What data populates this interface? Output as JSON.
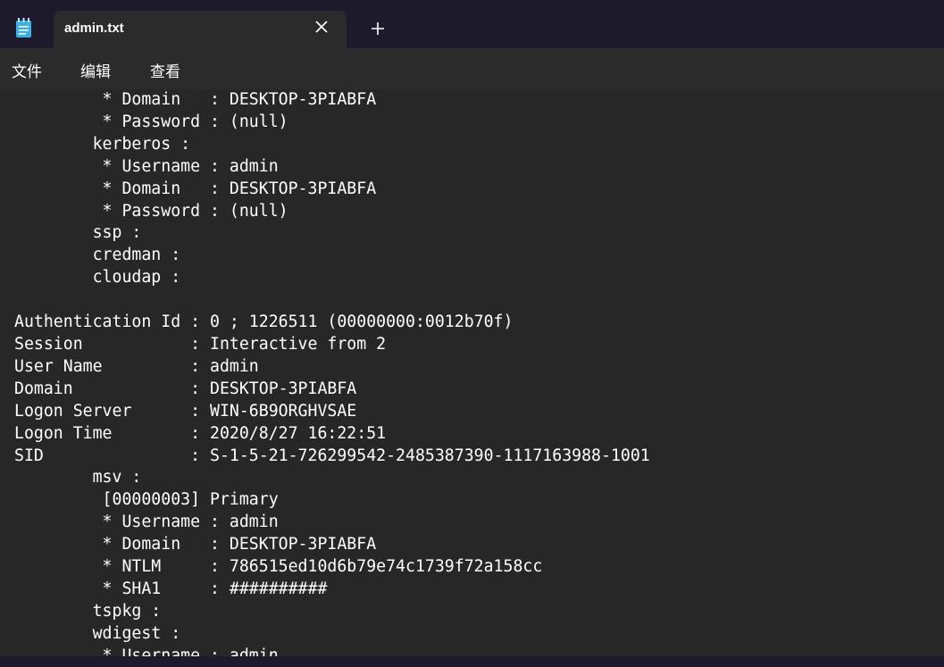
{
  "tab": {
    "title": "admin.txt"
  },
  "menu": {
    "items": [
      "文件",
      "编辑",
      "查看"
    ]
  },
  "icons": {
    "app": "notepad-icon",
    "close": "close-icon",
    "new_tab": "plus-icon"
  },
  "colors": {
    "titlebar": "#1d1a2b",
    "tab": "#2b2b2b",
    "editor": "#272727",
    "text": "#ffffff",
    "app_icon": "#3ab0e6"
  },
  "document": {
    "content": "         * Domain   : DESKTOP-3PIABFA\n         * Password : (null)\n        kerberos :\n         * Username : admin\n         * Domain   : DESKTOP-3PIABFA\n         * Password : (null)\n        ssp :\n        credman :\n        cloudap :\n\nAuthentication Id : 0 ; 1226511 (00000000:0012b70f)\nSession           : Interactive from 2\nUser Name         : admin\nDomain            : DESKTOP-3PIABFA\nLogon Server      : WIN-6B9ORGHVSAE\nLogon Time        : 2020/8/27 16:22:51\nSID               : S-1-5-21-726299542-2485387390-1117163988-1001\n        msv :\n         [00000003] Primary\n         * Username : admin\n         * Domain   : DESKTOP-3PIABFA\n         * NTLM     : 786515ed10d6b79e74c1739f72a158cc\n         * SHA1     : ##########\n        tspkg :\n        wdigest :\n         * Username : admin"
  }
}
